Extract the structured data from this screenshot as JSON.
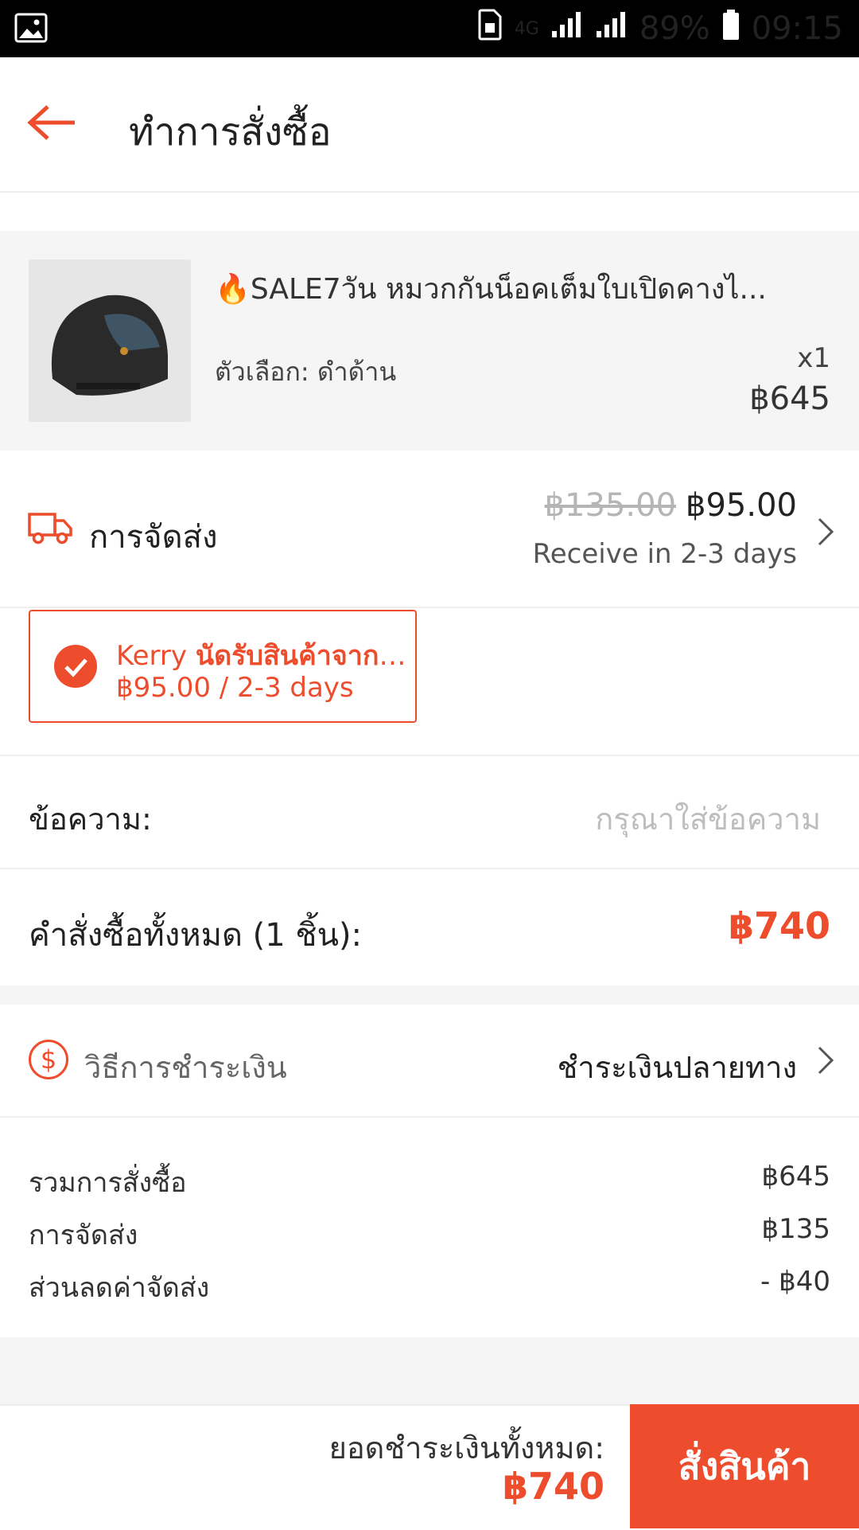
{
  "status": {
    "battery": "89%",
    "time": "09:15",
    "network": "4G"
  },
  "header": {
    "title": "ทำการสั่งซื้อ"
  },
  "product": {
    "name": "🔥SALE7วัน หมวกกันน็อคเต็มใบเปิดคางไ...",
    "variant": "ตัวเลือก: ดำด้าน",
    "qty": "x1",
    "price": "฿645"
  },
  "shipping": {
    "label": "การจัดส่ง",
    "old_price": "฿135.00",
    "price": "฿95.00",
    "days": "Receive in 2-3 days",
    "courier_brand": "Kerry",
    "courier_service": "นัดรับสินค้าจากร้า...",
    "courier_detail": "฿95.00 / 2-3 days"
  },
  "message": {
    "label": "ข้อความ:",
    "placeholder": "กรุณาใส่ข้อความ"
  },
  "order_total": {
    "label": "คำสั่งซื้อทั้งหมด (1 ชิ้น):",
    "value": "฿740"
  },
  "payment": {
    "label": "วิธีการชำระเงิน",
    "value": "ชำระเงินปลายทาง"
  },
  "summary": {
    "rows": [
      {
        "label": "รวมการสั่งซื้อ",
        "value": "฿645"
      },
      {
        "label": "การจัดส่ง",
        "value": "฿135"
      },
      {
        "label": "ส่วนลดค่าจัดส่ง",
        "value": "- ฿40"
      }
    ]
  },
  "bottom": {
    "total_label": "ยอดชำระเงินทั้งหมด:",
    "total_value": "฿740",
    "button": "สั่งสินค้า"
  },
  "colors": {
    "accent": "#ee4d2d"
  }
}
